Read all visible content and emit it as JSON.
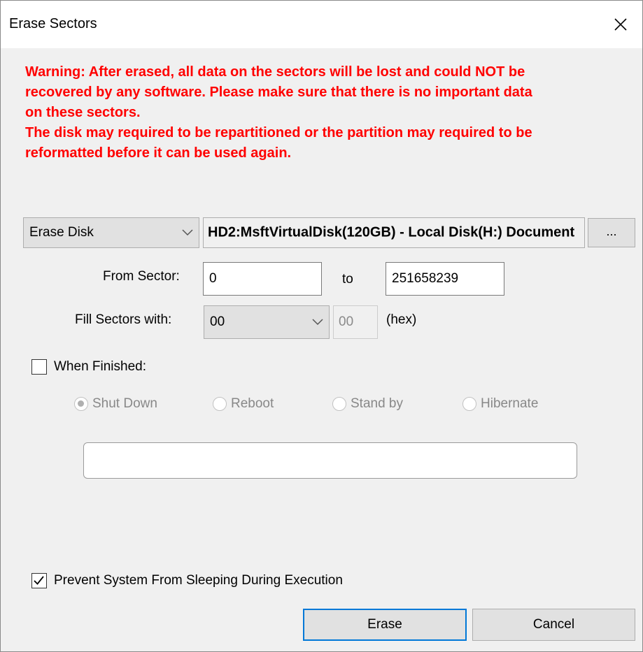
{
  "window": {
    "title": "Erase Sectors"
  },
  "warning": {
    "line1": "Warning: After erased, all data on the sectors will be lost and could NOT be\nrecovered by any software. Please make sure that there is no important data\non these sectors.",
    "line2": "The disk may required to be repartitioned or the partition may required to be\nreformatted before it can be used again."
  },
  "target": {
    "mode_value": "Erase Disk",
    "disk_value": "HD2:MsftVirtualDisk(120GB) - Local Disk(H:) Document",
    "browse_label": "..."
  },
  "sectors": {
    "from_label": "From Sector:",
    "from_value": "0",
    "to_label": "to",
    "to_value": "251658239"
  },
  "fill": {
    "label": "Fill Sectors with:",
    "value": "00",
    "hex_value": "00",
    "unit": "(hex)"
  },
  "when_finished": {
    "label": "When Finished:",
    "checked": false,
    "options": [
      "Shut Down",
      "Reboot",
      "Stand by",
      "Hibernate"
    ],
    "selected": "Shut Down"
  },
  "prevent_sleep": {
    "label": "Prevent System From Sleeping During Execution",
    "checked": true
  },
  "buttons": {
    "erase": "Erase",
    "cancel": "Cancel"
  },
  "colors": {
    "warning": "#ff0000",
    "default_button_border": "#0078d7"
  },
  "icons": [
    "close-icon",
    "chevron-down-icon",
    "checkmark-icon"
  ]
}
